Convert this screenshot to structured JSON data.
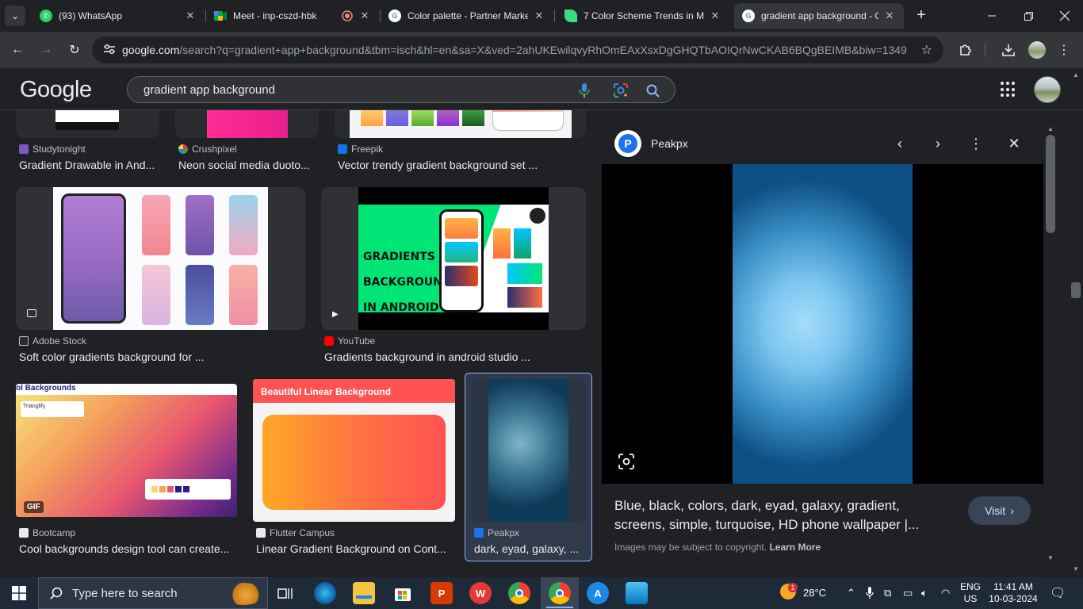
{
  "browser": {
    "tabs": [
      {
        "title": "(93) WhatsApp",
        "favicon": "whatsapp-icon",
        "color": "#25d366"
      },
      {
        "title": "Meet - inp-cszd-hbk",
        "favicon": "meet-icon",
        "color": "#00897b"
      },
      {
        "title": "Color palette - Partner Marke",
        "favicon": "google-icon",
        "color": "#4285f4"
      },
      {
        "title": "7 Color Scheme Trends in M",
        "favicon": "leaf-icon",
        "color": "#3ddc84"
      },
      {
        "title": "gradient app background - G",
        "favicon": "google-icon",
        "color": "#4285f4"
      }
    ],
    "url_host": "google.com",
    "url_path": "/search?q=gradient+app+background&tbm=isch&hl=en&sa=X&ved=2ahUKEwilqvyRhOmEAxXsxDgGHQTbAOIQrNwCKAB6BQgBEIMB&biw=1349..."
  },
  "google": {
    "logo": "Google",
    "query": "gradient app background"
  },
  "results": [
    {
      "source": "Studytonight",
      "caption": "Gradient Drawable in And..."
    },
    {
      "source": "Crushpixel",
      "caption": "Neon social media duoto..."
    },
    {
      "source": "Freepik",
      "caption": "Vector trendy gradient background set ..."
    },
    {
      "source": "Adobe Stock",
      "caption": "Soft color gradients background for ..."
    },
    {
      "source": "YouTube",
      "caption": "Gradients background in android studio ..."
    },
    {
      "source": "Bootcamp",
      "caption": "Cool backgrounds design tool can create..."
    },
    {
      "source": "Flutter Campus",
      "caption": "Linear Gradient Background on Cont..."
    },
    {
      "source": "Peakpx",
      "caption": "dark, eyad, galaxy, ..."
    }
  ],
  "thumb_text": {
    "youtube": {
      "line1": "GRADIENTS",
      "line2": "BACKGROUND",
      "line3": "IN ANDROID"
    },
    "bootcamp": {
      "heading": "ol Backgrounds",
      "app": "Trianglify",
      "badge": "GIF"
    },
    "flutter": {
      "heading": "Beautiful Linear Background"
    }
  },
  "panel": {
    "site": "Peakpx",
    "title": "Blue, black, colors, dark, eyad, galaxy, gradient, screens, simple, turquoise, HD phone wallpaper |...",
    "visit": "Visit",
    "copyright": "Images may be subject to copyright.",
    "learn_more": "Learn More"
  },
  "taskbar": {
    "search_placeholder": "Type here to search",
    "weather": "28°C",
    "weather_badge": "1",
    "lang_line1": "ENG",
    "lang_line2": "US",
    "time": "11:41 AM",
    "date": "10-03-2024"
  }
}
